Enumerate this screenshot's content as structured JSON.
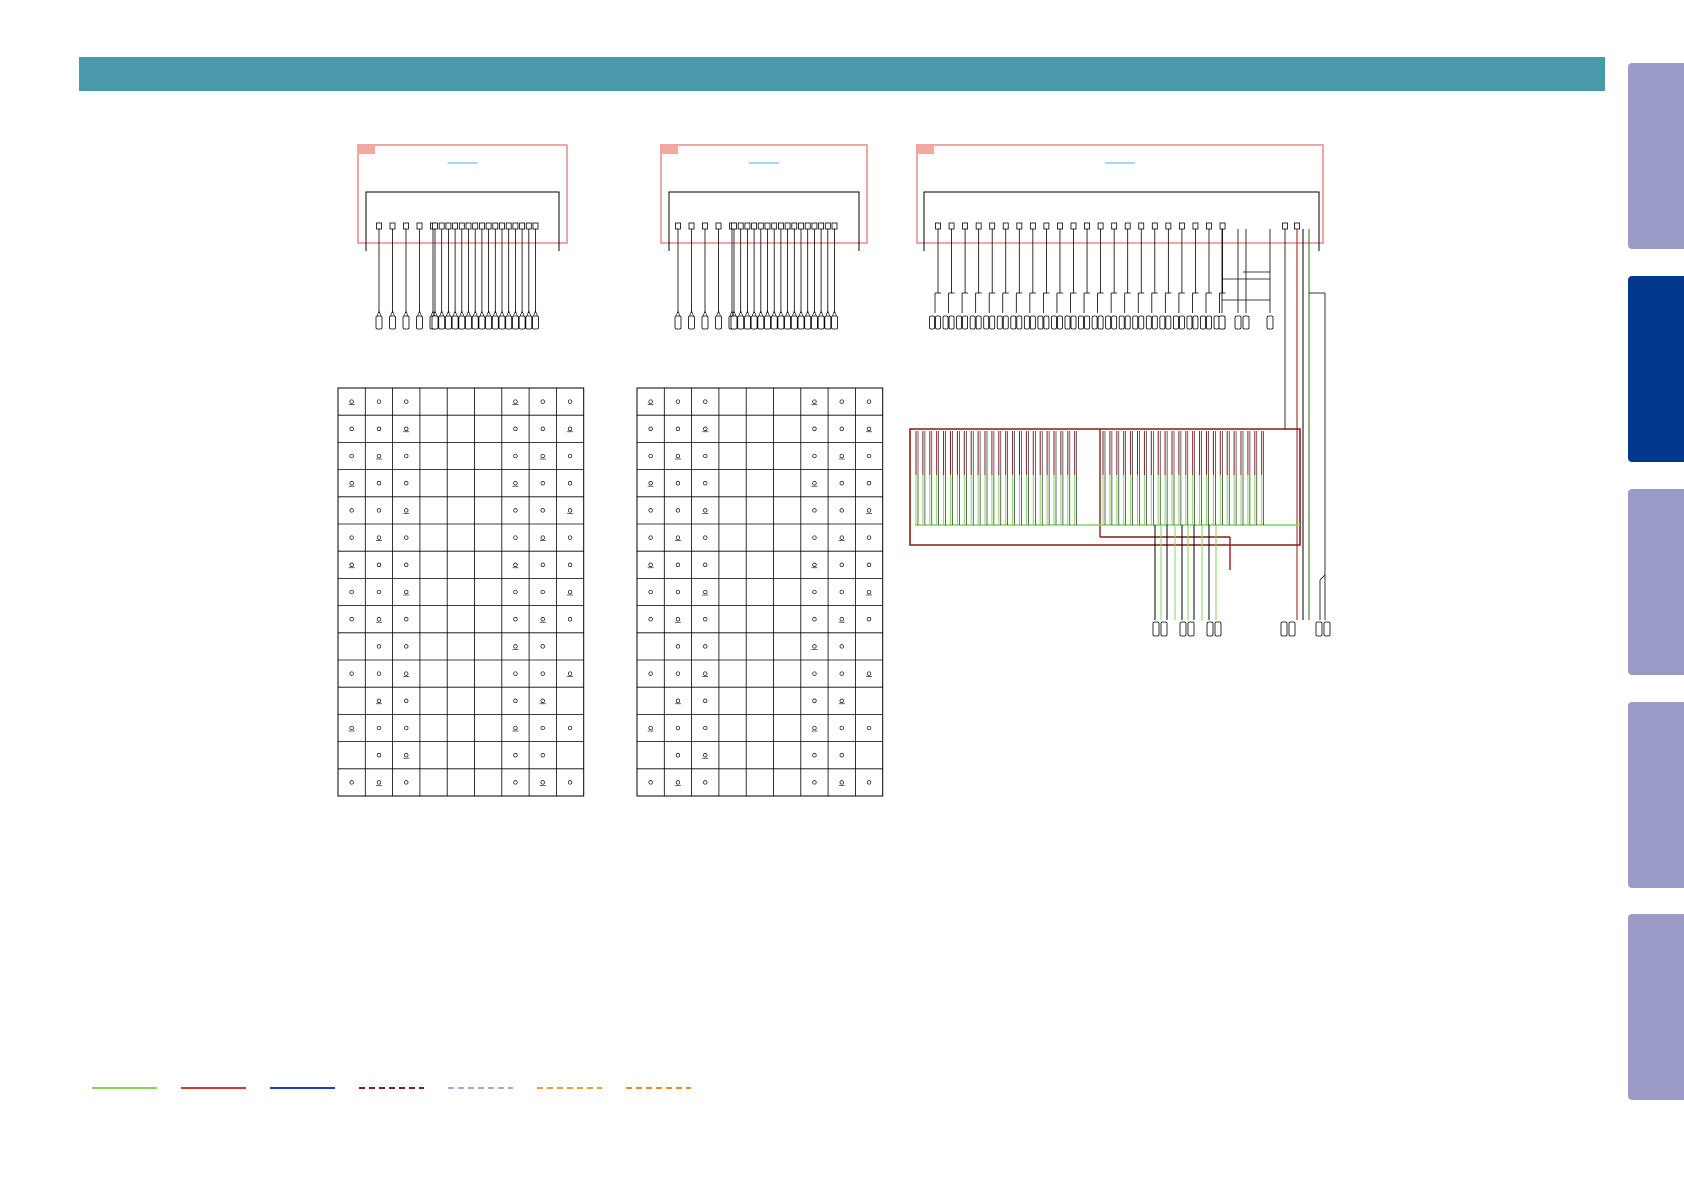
{
  "page": {
    "header_color": "#4a9aac"
  },
  "side_tabs": [
    {
      "active": false
    },
    {
      "active": true
    },
    {
      "active": false
    },
    {
      "active": false
    },
    {
      "active": false
    }
  ],
  "tab_colors": {
    "inactive": "#9b9bc8",
    "active": "#02388d"
  },
  "colors": {
    "module_border": "#e88a8a",
    "module_corner": "#f4a8a0",
    "wire": "#000000",
    "bus_red": "#8b1a1a",
    "bus_green": "#7ed957",
    "title_line": "#4fb3d9",
    "grid_line": "#000000"
  },
  "legend": [
    {
      "color": "#7ed957",
      "style": "solid"
    },
    {
      "color": "#d63a2a",
      "style": "solid"
    },
    {
      "color": "#1f3fb0",
      "style": "solid"
    },
    {
      "color": "#8b1a1a",
      "style": "dashed"
    },
    {
      "color": "#a8a8e0",
      "style": "dashed"
    },
    {
      "color": "#f0a030",
      "style": "dashed"
    },
    {
      "color": "#f08a30",
      "style": "dashed"
    }
  ]
}
